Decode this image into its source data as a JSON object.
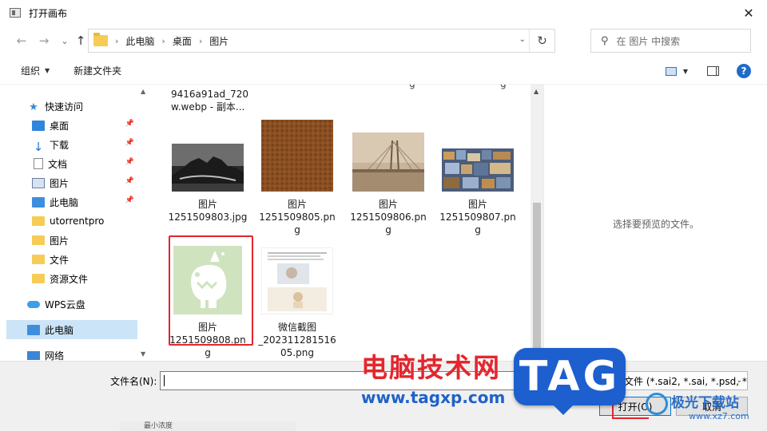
{
  "window": {
    "title": "打开画布",
    "close_glyph": "✕"
  },
  "nav": {
    "back_glyph": "←",
    "forward_glyph": "→",
    "recent_glyph": "⌄",
    "up_glyph": "↑",
    "breadcrumb": [
      "此电脑",
      "桌面",
      "图片"
    ],
    "crumb_sep": "›",
    "dropdown_glyph": "⌄",
    "refresh_glyph": "↻",
    "search_placeholder": "在 图片 中搜索",
    "search_glyph": "⚲"
  },
  "toolbar": {
    "organize": "组织",
    "new_folder": "新建文件夹",
    "help": "?"
  },
  "sidebar": {
    "items": [
      {
        "label": "快速访问",
        "icon": "star-icon",
        "pinned": false
      },
      {
        "label": "桌面",
        "icon": "desktop-icon",
        "pinned": true
      },
      {
        "label": "下载",
        "icon": "download-icon",
        "pinned": true
      },
      {
        "label": "文档",
        "icon": "document-icon",
        "pinned": true
      },
      {
        "label": "图片",
        "icon": "pictures-icon",
        "pinned": true
      },
      {
        "label": "此电脑",
        "icon": "computer-icon",
        "pinned": true
      },
      {
        "label": "utorrentpro",
        "icon": "folder-icon",
        "pinned": false
      },
      {
        "label": "图片",
        "icon": "folder-icon",
        "pinned": false
      },
      {
        "label": "文件",
        "icon": "folder-icon",
        "pinned": false
      },
      {
        "label": "资源文件",
        "icon": "folder-icon",
        "pinned": false
      },
      {
        "label": "WPS云盘",
        "icon": "cloud-icon",
        "pinned": false
      },
      {
        "label": "此电脑",
        "icon": "computer-icon",
        "pinned": false,
        "selected": true
      },
      {
        "label": "网络",
        "icon": "network-icon",
        "pinned": false
      }
    ]
  },
  "files": {
    "partial_top": {
      "lines": [
        "9416a91ad_720",
        "w.webp - 副本..."
      ]
    },
    "tiles": [
      {
        "lines": [
          "图片",
          "1251509803.jpg"
        ],
        "thumb": "rock-photo"
      },
      {
        "lines": [
          "图片",
          "1251509805.pn",
          "g"
        ],
        "thumb": "leather-texture"
      },
      {
        "lines": [
          "图片",
          "1251509806.pn",
          "g"
        ],
        "thumb": "bridge-photo"
      },
      {
        "lines": [
          "图片",
          "1251509807.pn",
          "g"
        ],
        "thumb": "collage-photo"
      },
      {
        "lines": [
          "图片",
          "1251509808.pn",
          "g"
        ],
        "thumb": "cartoon-creature",
        "highlighted": true
      },
      {
        "lines": [
          "微信截图",
          "_202311281516",
          "05.png"
        ],
        "thumb": "screenshot-doc"
      }
    ]
  },
  "preview": {
    "empty_text": "选择要预览的文件。"
  },
  "bottom": {
    "filename_label": "文件名(N):",
    "filename_value": "",
    "filetype": "画布文件 (*.sai2, *.sai, *.psd, *",
    "open_button": "打开(O)",
    "cancel_button": "取消",
    "strip_text": "最小浓度"
  },
  "watermark": {
    "cn": "电脑技术网",
    "url": "www.tagxp.com",
    "tag": "TAG",
    "site_name": "极光下载站",
    "site_url": "www.xz7.com"
  },
  "colors": {
    "accent": "#0078d7",
    "selection": "#cce4f7",
    "highlight_red": "#e0262d",
    "watermark_blue": "#1d5fce"
  }
}
